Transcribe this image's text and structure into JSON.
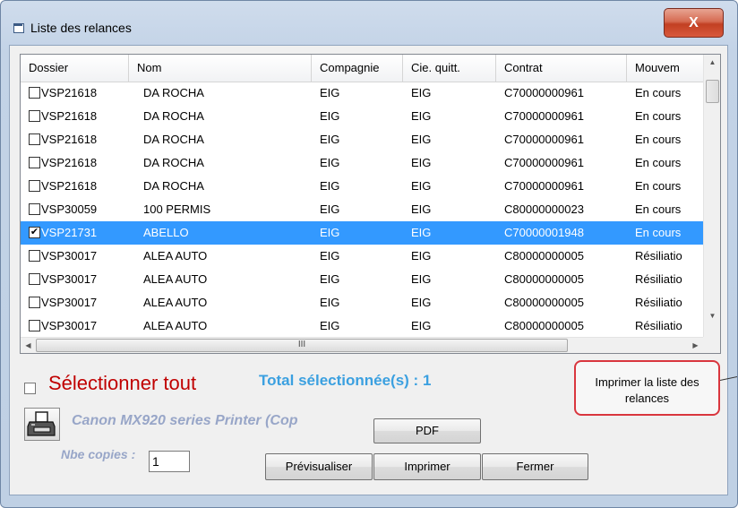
{
  "window": {
    "title": "Liste des relances",
    "close_glyph": "X"
  },
  "grid": {
    "columns": [
      "Dossier",
      "Nom",
      "Compagnie",
      "Cie. quitt.",
      "Contrat",
      "Mouvem"
    ],
    "rows": [
      {
        "checked": false,
        "selected": false,
        "dossier": "VSP21618",
        "nom": "DA ROCHA",
        "compagnie": "EIG",
        "cie_quitt": "EIG",
        "contrat": "C70000000961",
        "mouvement": "En cours"
      },
      {
        "checked": false,
        "selected": false,
        "dossier": "VSP21618",
        "nom": "DA ROCHA",
        "compagnie": "EIG",
        "cie_quitt": "EIG",
        "contrat": "C70000000961",
        "mouvement": "En cours"
      },
      {
        "checked": false,
        "selected": false,
        "dossier": "VSP21618",
        "nom": "DA ROCHA",
        "compagnie": "EIG",
        "cie_quitt": "EIG",
        "contrat": "C70000000961",
        "mouvement": "En cours"
      },
      {
        "checked": false,
        "selected": false,
        "dossier": "VSP21618",
        "nom": "DA ROCHA",
        "compagnie": "EIG",
        "cie_quitt": "EIG",
        "contrat": "C70000000961",
        "mouvement": "En cours"
      },
      {
        "checked": false,
        "selected": false,
        "dossier": "VSP21618",
        "nom": "DA ROCHA",
        "compagnie": "EIG",
        "cie_quitt": "EIG",
        "contrat": "C70000000961",
        "mouvement": "En cours"
      },
      {
        "checked": false,
        "selected": false,
        "dossier": "VSP30059",
        "nom": "100 PERMIS",
        "compagnie": "EIG",
        "cie_quitt": "EIG",
        "contrat": "C80000000023",
        "mouvement": "En cours"
      },
      {
        "checked": true,
        "selected": true,
        "dossier": "VSP21731",
        "nom": "ABELLO",
        "compagnie": "EIG",
        "cie_quitt": "EIG",
        "contrat": "C70000001948",
        "mouvement": "En cours"
      },
      {
        "checked": false,
        "selected": false,
        "dossier": "VSP30017",
        "nom": "ALEA AUTO",
        "compagnie": "EIG",
        "cie_quitt": "EIG",
        "contrat": "C80000000005",
        "mouvement": "Résiliatio"
      },
      {
        "checked": false,
        "selected": false,
        "dossier": "VSP30017",
        "nom": "ALEA AUTO",
        "compagnie": "EIG",
        "cie_quitt": "EIG",
        "contrat": "C80000000005",
        "mouvement": "Résiliatio"
      },
      {
        "checked": false,
        "selected": false,
        "dossier": "VSP30017",
        "nom": "ALEA AUTO",
        "compagnie": "EIG",
        "cie_quitt": "EIG",
        "contrat": "C80000000005",
        "mouvement": "Résiliatio"
      },
      {
        "checked": false,
        "selected": false,
        "dossier": "VSP30017",
        "nom": "ALEA AUTO",
        "compagnie": "EIG",
        "cie_quitt": "EIG",
        "contrat": "C80000000005",
        "mouvement": "Résiliatio"
      }
    ],
    "hscroll_grip": "III",
    "selected_row_color": "#3399ff"
  },
  "footer": {
    "select_all_label": "Sélectionner tout",
    "total_label": "Total sélectionnée(s) : 1",
    "print_list_label": "Imprimer la liste des relances",
    "printer_icon": "printer-icon",
    "printer_name": "Canon MX920 series Printer (Cop",
    "pdf_label": "PDF",
    "copies_label": "Nbe copies :",
    "copies_value": "1",
    "preview_label": "Prévisualiser",
    "print_label": "Imprimer",
    "close_label": "Fermer"
  },
  "colors": {
    "select_all": "#c00000",
    "total": "#3ba0e0",
    "highlight_border": "#d9363e"
  }
}
